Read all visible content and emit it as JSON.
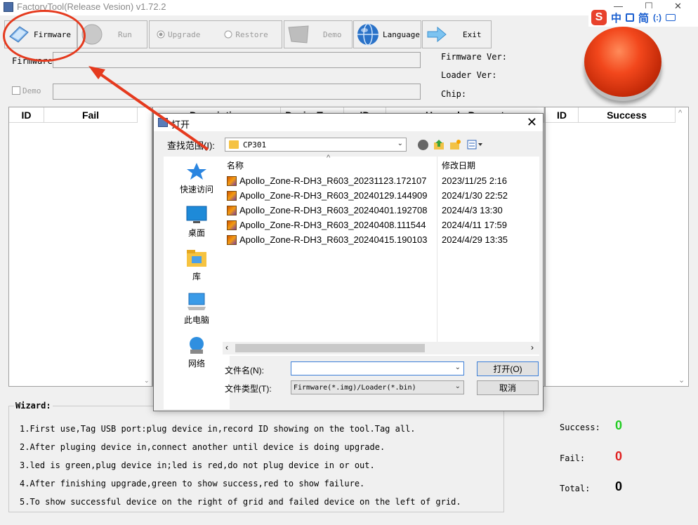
{
  "app": {
    "title": "FactoryTool(Release Vesion) v1.72.2",
    "window_controls": {
      "minimize": "—",
      "maximize": "☐",
      "close": "✕"
    }
  },
  "ime": {
    "logo": "S",
    "items": [
      "中",
      "简",
      "(:)"
    ]
  },
  "toolbar": {
    "firmware": "Firmware",
    "run": "Run",
    "upgrade": "Upgrade",
    "restore": "Restore",
    "demo": "Demo",
    "language": "Language",
    "exit": "Exit"
  },
  "form": {
    "firmware_label": "Firmware",
    "demo_label": "Demo",
    "firmware_ver": "Firmware Ver:",
    "loader_ver": "Loader Ver:",
    "chip": "Chip:"
  },
  "left_grid": {
    "columns": [
      "ID",
      "Fail"
    ]
  },
  "middle_grid": {
    "columns": [
      "Description",
      "DeviceType",
      "ID",
      "Upgrade Percent"
    ]
  },
  "right_grid": {
    "columns": [
      "ID",
      "Success"
    ]
  },
  "wizard": {
    "title": "Wizard:",
    "lines": [
      "1.First use,Tag USB port:plug device in,record ID showing on the tool.Tag all.",
      "2.After pluging device in,connect another until device is doing upgrade.",
      "3.led is green,plug device in;led is red,do not plug device in or out.",
      "4.After finishing upgrade,green to show success,red to show failure.",
      "5.To show successful device on the right of grid and failed device on the left of grid."
    ]
  },
  "stats": {
    "success_label": "Success:",
    "success_value": "0",
    "success_color": "#22cc22",
    "fail_label": "Fail:",
    "fail_value": "0",
    "fail_color": "#e02020",
    "total_label": "Total:",
    "total_value": "0"
  },
  "dialog": {
    "title": "打开",
    "close": "✕",
    "lookin_label": "查找范围(I):",
    "lookin_value": "CP301",
    "places": [
      "快速访问",
      "桌面",
      "库",
      "此电脑",
      "网络"
    ],
    "col_name": "名称",
    "col_date": "修改日期",
    "files": [
      {
        "name": "Apollo_Zone-R-DH3_R603_20231123.172107",
        "date": "2023/11/25 2:16"
      },
      {
        "name": "Apollo_Zone-R-DH3_R603_20240129.144909",
        "date": "2024/1/30 22:52"
      },
      {
        "name": "Apollo_Zone-R-DH3_R603_20240401.192708",
        "date": "2024/4/3 13:30"
      },
      {
        "name": "Apollo_Zone-R-DH3_R603_20240408.111544",
        "date": "2024/4/11 17:59"
      },
      {
        "name": "Apollo_Zone-R-DH3_R603_20240415.190103",
        "date": "2024/4/29 13:35"
      }
    ],
    "filename_label": "文件名(N):",
    "filename_value": "",
    "filetype_label": "文件类型(T):",
    "filetype_value": "Firmware(*.img)/Loader(*.bin)",
    "open_button": "打开(O)",
    "cancel_button": "取消"
  },
  "colors": {
    "annotation": "#e53a1e"
  }
}
